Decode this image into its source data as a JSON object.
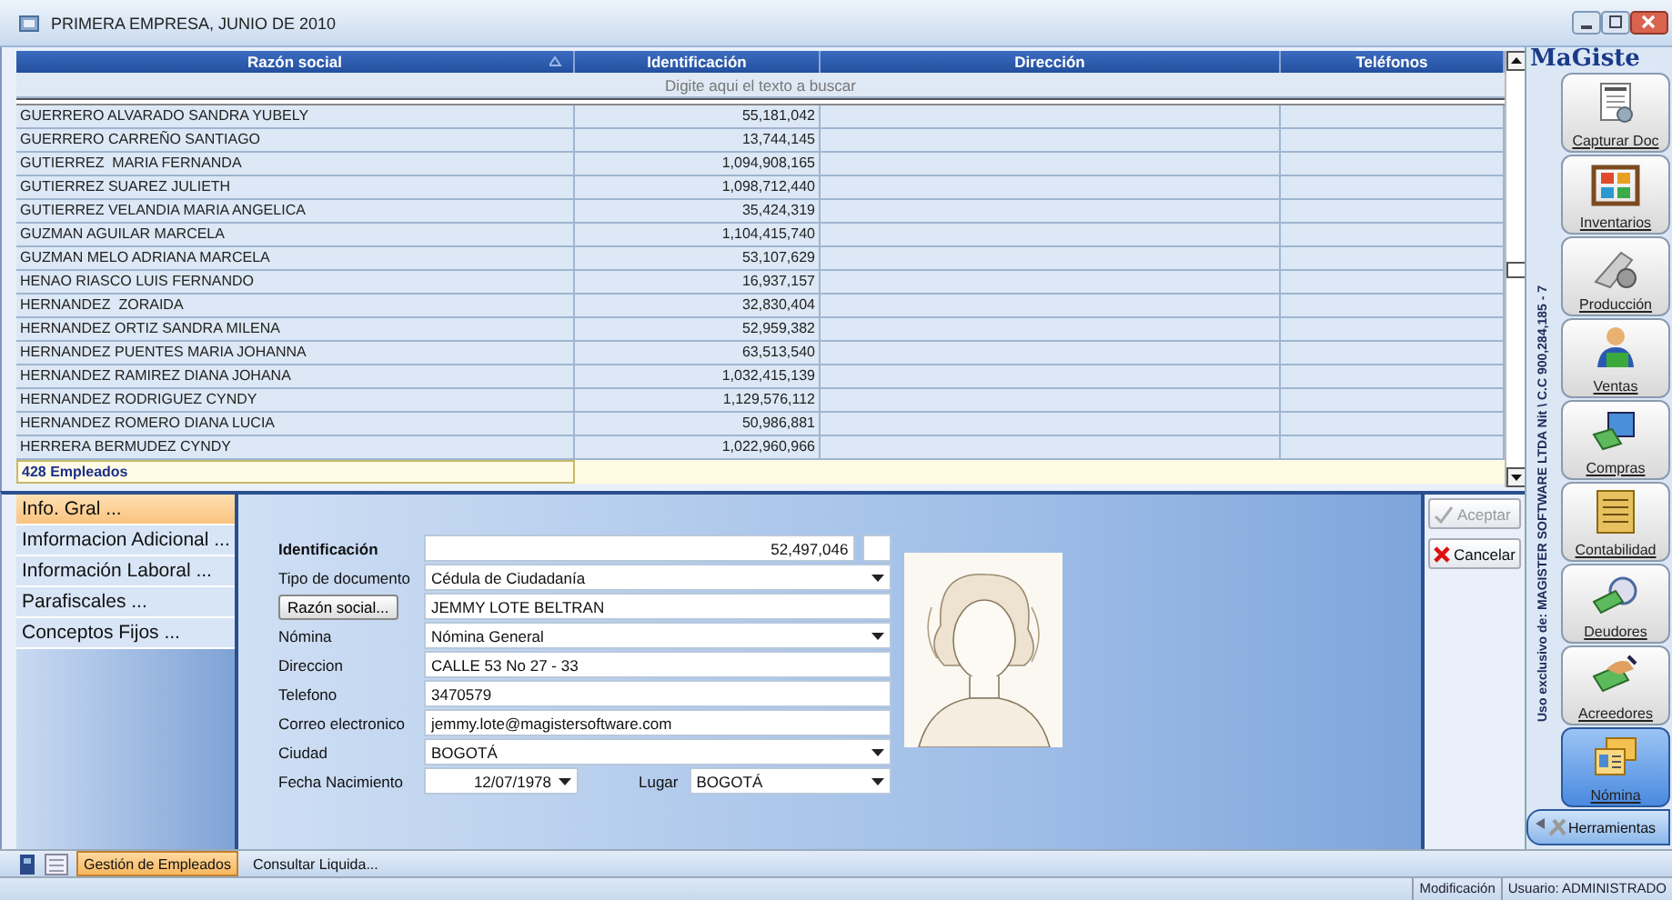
{
  "window": {
    "title": "PRIMERA EMPRESA, JUNIO DE 2010"
  },
  "table": {
    "columns": [
      {
        "label": "Razón social",
        "sorted": true
      },
      {
        "label": "Identificación",
        "sorted": false
      },
      {
        "label": "Dirección",
        "sorted": false
      },
      {
        "label": "Teléfonos",
        "sorted": false
      }
    ],
    "search": {
      "placeholder": "Digite aqui el texto a buscar"
    },
    "rows": [
      {
        "razon_social": "GUERRERO ALVARADO SANDRA YUBELY",
        "identificacion": "55,181,042"
      },
      {
        "razon_social": "GUERRERO CARREÑO SANTIAGO",
        "identificacion": "13,744,145"
      },
      {
        "razon_social": "GUTIERREZ  MARIA FERNANDA",
        "identificacion": "1,094,908,165"
      },
      {
        "razon_social": "GUTIERREZ SUAREZ JULIETH",
        "identificacion": "1,098,712,440"
      },
      {
        "razon_social": "GUTIERREZ VELANDIA MARIA ANGELICA",
        "identificacion": "35,424,319"
      },
      {
        "razon_social": "GUZMAN AGUILAR MARCELA",
        "identificacion": "1,104,415,740"
      },
      {
        "razon_social": "GUZMAN MELO ADRIANA MARCELA",
        "identificacion": "53,107,629"
      },
      {
        "razon_social": "HENAO RIASCO LUIS FERNANDO",
        "identificacion": "16,937,157"
      },
      {
        "razon_social": "HERNANDEZ  ZORAIDA",
        "identificacion": "32,830,404"
      },
      {
        "razon_social": "HERNANDEZ ORTIZ SANDRA MILENA",
        "identificacion": "52,959,382"
      },
      {
        "razon_social": "HERNANDEZ PUENTES MARIA JOHANNA",
        "identificacion": "63,513,540"
      },
      {
        "razon_social": "HERNANDEZ RAMIREZ DIANA JOHANA",
        "identificacion": "1,032,415,139"
      },
      {
        "razon_social": "HERNANDEZ RODRIGUEZ CYNDY",
        "identificacion": "1,129,576,112"
      },
      {
        "razon_social": "HERNANDEZ ROMERO DIANA LUCIA",
        "identificacion": "50,986,881"
      },
      {
        "razon_social": "HERRERA BERMUDEZ CYNDY",
        "identificacion": "1,022,960,966"
      }
    ],
    "count": "428 Empleados"
  },
  "form": {
    "nav": [
      {
        "label": "Info. Gral ...",
        "selected": true
      },
      {
        "label": "Imformacion Adicional ...",
        "selected": false
      },
      {
        "label": "Información Laboral ...",
        "selected": false
      },
      {
        "label": "Parafiscales ...",
        "selected": false
      },
      {
        "label": "Conceptos Fijos ...",
        "selected": false
      }
    ],
    "fields": [
      {
        "label": "Identificación",
        "label_bold": true,
        "label_button": false,
        "kind": "number",
        "value": "52,497,046"
      },
      {
        "label": "Tipo de documento",
        "label_bold": false,
        "label_button": false,
        "kind": "select",
        "value": "Cédula de Ciudadanía"
      },
      {
        "label": "Razón social...",
        "label_bold": false,
        "label_button": true,
        "kind": "text",
        "value": "JEMMY LOTE BELTRAN"
      },
      {
        "label": "Nómina",
        "label_bold": false,
        "label_button": false,
        "kind": "select",
        "value": "Nómina General"
      },
      {
        "label": "Direccion",
        "label_bold": false,
        "label_button": false,
        "kind": "text",
        "value": "CALLE 53 No 27 - 33"
      },
      {
        "label": "Telefono",
        "label_bold": false,
        "label_button": false,
        "kind": "text",
        "value": "3470579"
      },
      {
        "label": "Correo electronico",
        "label_bold": false,
        "label_button": false,
        "kind": "text",
        "value": "jemmy.lote@magistersoftware.com"
      },
      {
        "label": "Ciudad",
        "label_bold": false,
        "label_button": false,
        "kind": "select",
        "value": "BOGOTÁ"
      },
      {
        "label": "Fecha Nacimiento",
        "label_bold": false,
        "label_button": false,
        "kind": "date",
        "value": "12/07/1978",
        "extra": {
          "label": "Lugar",
          "value": "BOGOTÁ"
        }
      }
    ],
    "actions": [
      {
        "label": "Aceptar",
        "kind": "accept",
        "disabled": true
      },
      {
        "label": "Cancelar",
        "kind": "cancel",
        "disabled": false
      }
    ]
  },
  "sidebar": {
    "brand": "MaGiste",
    "license": "Uso exclusivo de: MAGISTER SOFTWARE LTDA Nit \\ C.C 900,284,185 - 7",
    "modules": [
      {
        "label": "Capturar Doc",
        "selected": false
      },
      {
        "label": "Inventarios",
        "selected": false
      },
      {
        "label": "Producción",
        "selected": false
      },
      {
        "label": "Ventas",
        "selected": false
      },
      {
        "label": "Compras",
        "selected": false
      },
      {
        "label": "Contabilidad",
        "selected": false
      },
      {
        "label": "Deudores",
        "selected": false
      },
      {
        "label": "Acreedores",
        "selected": false
      },
      {
        "label": "Nómina",
        "selected": true
      }
    ],
    "tools": "Herramientas"
  },
  "tabs": [
    {
      "label": "Gestión de Empleados",
      "selected": true
    },
    {
      "label": "Consultar Liquida...",
      "selected": false
    }
  ],
  "status_bar": [
    "Modificación",
    "Usuario: ADMINISTRADO"
  ]
}
